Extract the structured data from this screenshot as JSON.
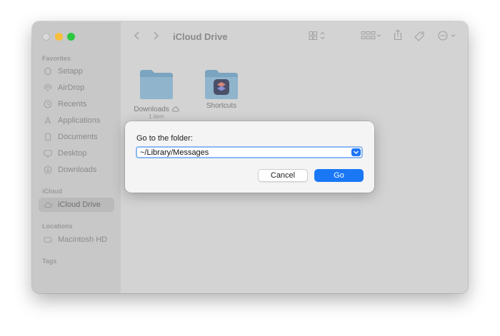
{
  "sidebar": {
    "favorites_title": "Favorites",
    "favorites": [
      {
        "label": "Setapp",
        "icon": "setapp-icon"
      },
      {
        "label": "AirDrop",
        "icon": "airdrop-icon"
      },
      {
        "label": "Recents",
        "icon": "clock-icon"
      },
      {
        "label": "Applications",
        "icon": "applications-icon"
      },
      {
        "label": "Documents",
        "icon": "document-icon"
      },
      {
        "label": "Desktop",
        "icon": "desktop-icon"
      },
      {
        "label": "Downloads",
        "icon": "download-icon"
      }
    ],
    "icloud_title": "iCloud",
    "icloud": [
      {
        "label": "iCloud Drive",
        "icon": "cloud-icon",
        "selected": true
      }
    ],
    "locations_title": "Locations",
    "locations": [
      {
        "label": "Macintosh HD",
        "icon": "disk-icon"
      }
    ],
    "tags_title": "Tags"
  },
  "toolbar": {
    "title": "iCloud Drive"
  },
  "files": [
    {
      "name": "Downloads",
      "sub": "1 item",
      "icon": "folder-icon"
    },
    {
      "name": "Shortcuts",
      "icon": "shortcuts-folder-icon"
    }
  ],
  "dialog": {
    "prompt": "Go to the folder:",
    "path_value": "~/Library/Messages",
    "cancel_label": "Cancel",
    "go_label": "Go"
  },
  "colors": {
    "accent": "#1a78f6",
    "window_bg": "#d3d3d3",
    "sidebar_bg": "#c8c8c8"
  }
}
